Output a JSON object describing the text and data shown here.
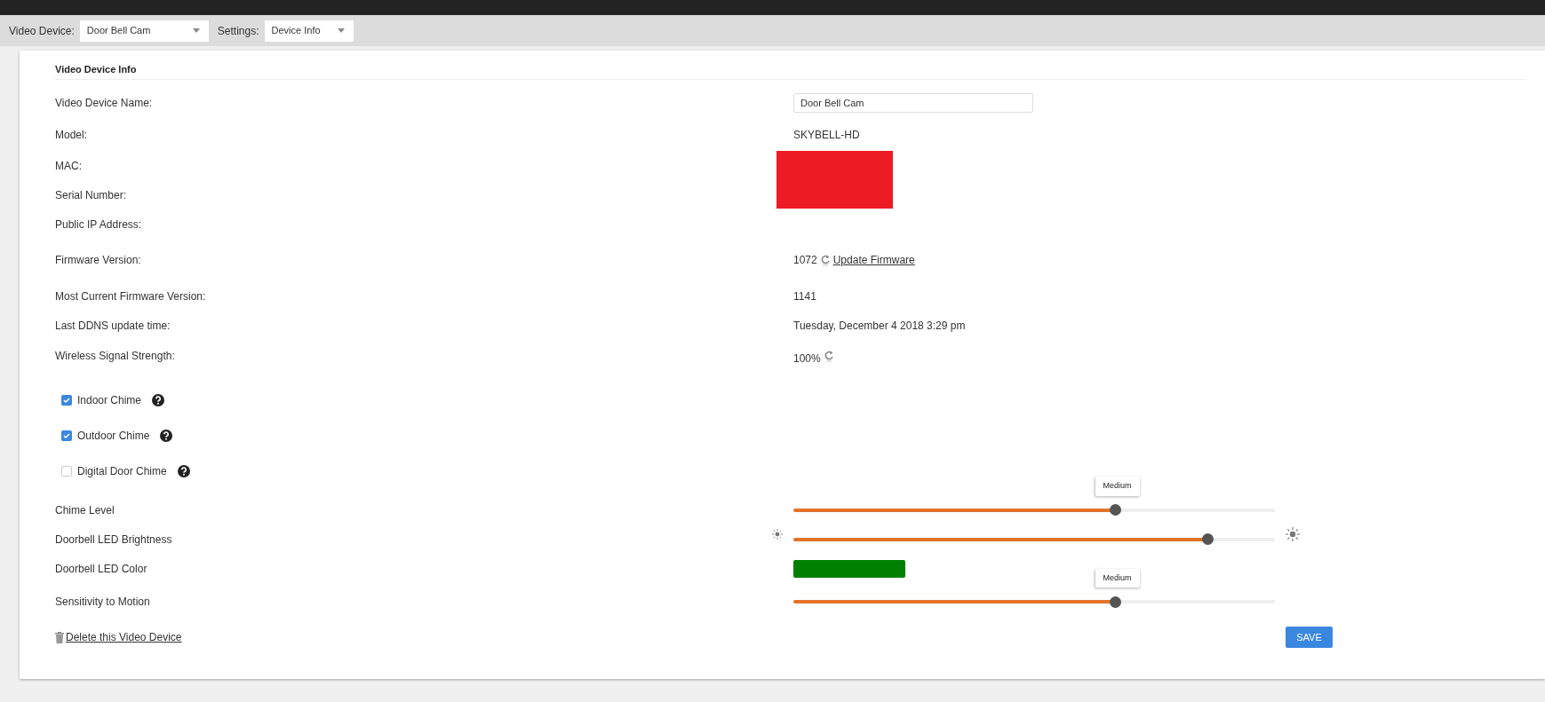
{
  "toolbar": {
    "dropdowns": [
      {
        "label": "Video Device:",
        "value": "Door Bell Cam"
      },
      {
        "label": "Settings:",
        "value": "Device Info"
      }
    ]
  },
  "section_title": "Video Device Info",
  "info_rows": [
    {
      "kind": "input",
      "label": "Video Device Name:",
      "value": "Door Bell Cam"
    },
    {
      "kind": "text",
      "label": "Model:",
      "value": "SKYBELL-HD"
    },
    {
      "kind": "hidden",
      "label": "MAC:"
    },
    {
      "kind": "hidden",
      "label": "Serial Number:"
    },
    {
      "kind": "hidden",
      "label": "Public IP Address:"
    },
    {
      "kind": "firmware",
      "label": "Firmware Version:",
      "value": "1072",
      "link": "Update Firmware"
    },
    {
      "kind": "text",
      "label": "Most Current Firmware Version:",
      "value": "1141"
    },
    {
      "kind": "text",
      "label": "Last DDNS update time:",
      "value": "Tuesday, December 4 2018 3:29 pm"
    },
    {
      "kind": "refresh",
      "label": "Wireless Signal Strength:",
      "value": "100%"
    }
  ],
  "chimes": [
    {
      "label": "Indoor Chime",
      "checked": true
    },
    {
      "label": "Outdoor Chime",
      "checked": true
    },
    {
      "label": "Digital Door Chime",
      "checked": false
    }
  ],
  "controls": [
    {
      "kind": "slider",
      "label": "Chime Level",
      "level": 0.667,
      "tooltip": "Medium"
    },
    {
      "kind": "brightness",
      "label": "Doorbell LED Brightness",
      "level": 0.86
    },
    {
      "kind": "color",
      "label": "Doorbell LED Color",
      "color": "#008000"
    },
    {
      "kind": "slider",
      "label": "Sensitivity to Motion",
      "level": 0.667,
      "tooltip": "Medium"
    }
  ],
  "delete_link": "Delete this Video Device",
  "save_button": "SAVE"
}
